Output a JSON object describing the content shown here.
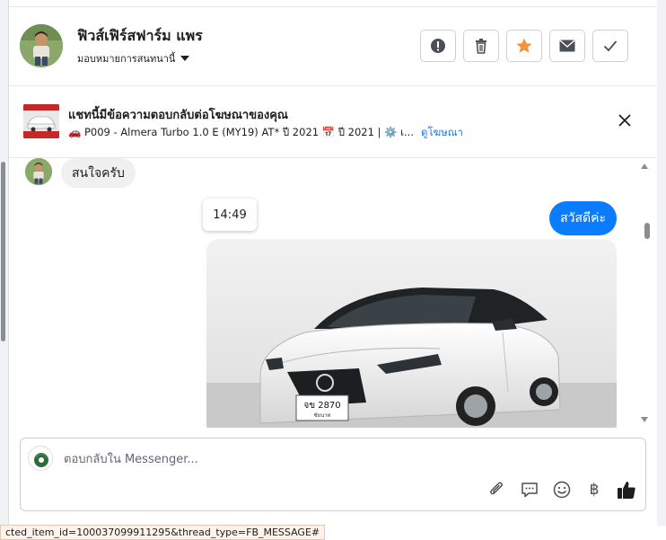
{
  "header": {
    "contact_name": "ฟิวส์เฟิร์สฟาร์ม แพร",
    "assign_label": "มอบหมายการสนทนานี้"
  },
  "actions": {
    "spam_icon": "exclamation-icon",
    "delete_icon": "trash-icon",
    "star_icon": "star-icon",
    "unread_icon": "envelope-icon",
    "done_icon": "check-icon",
    "star_color": "#f7923b"
  },
  "ad": {
    "title": "แชทนี้มีข้อความตอบกลับต่อโฆษณาของคุณ",
    "desc_car": "🚗 P009 - Almera Turbo 1.0 E (MY19) AT* ปี 2021 📅 ปี 2021 | ⚙️ เ...",
    "link": "ดูโฆษณา",
    "close_icon": "close-icon"
  },
  "thread": {
    "incoming_message": "สนใจครับ",
    "timestamp": "14:49",
    "outgoing_message": "สวัสดีค่ะ",
    "photo_plate": "จข 2870",
    "photo_plate_sub": "ชัยนาท",
    "outgoing_color": "#0a7cff"
  },
  "composer": {
    "placeholder": "ตอบกลับใน Messenger...",
    "attach_icon": "paperclip-icon",
    "saved_reply_icon": "chat-bubble-icon",
    "emoji_icon": "smiley-icon",
    "payment_symbol": "฿",
    "like_icon": "thumbs-up-icon"
  },
  "status_bar": {
    "url": "cted_item_id=100037099911295&thread_type=FB_MESSAGE#"
  }
}
